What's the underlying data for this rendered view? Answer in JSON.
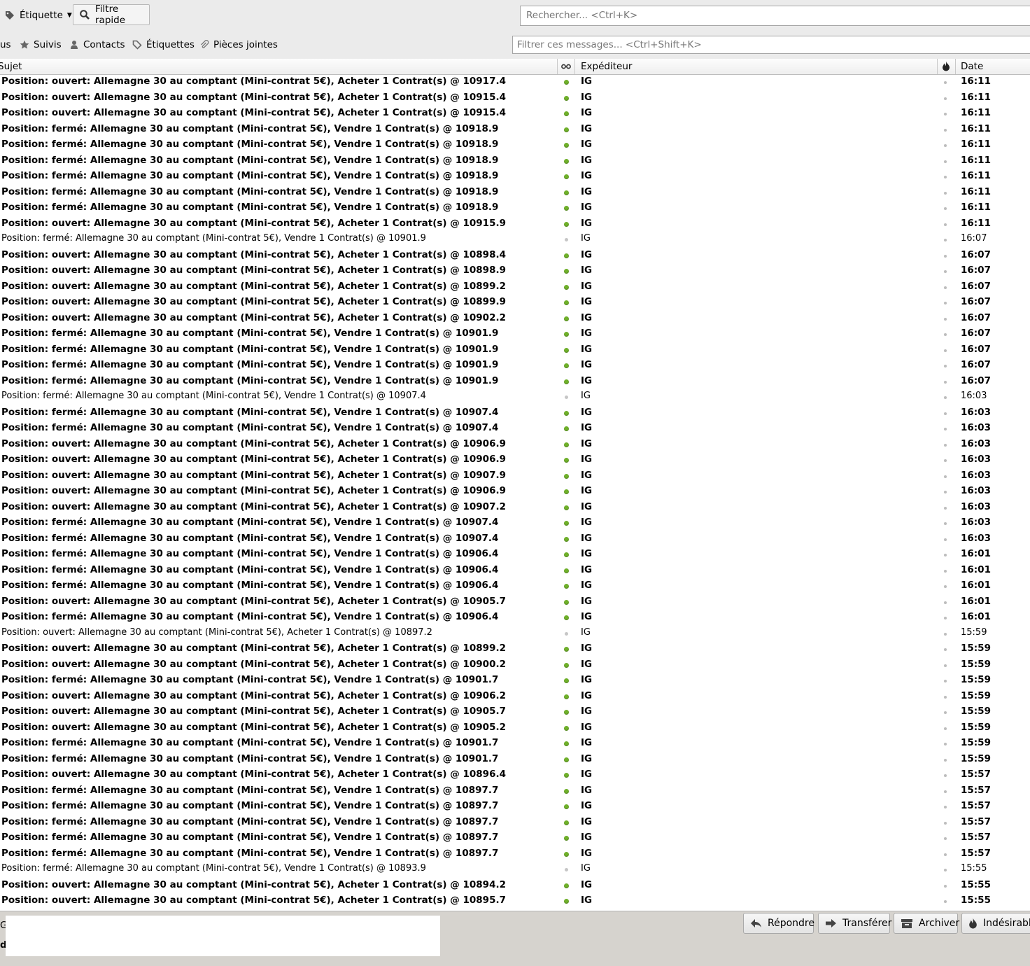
{
  "toolbar": {
    "tag_button_label": "Étiquette",
    "quick_filter_label": "Filtre rapide",
    "search_placeholder": "Rechercher... <Ctrl+K>"
  },
  "filterbar": {
    "partial_label": "us",
    "starred_label": "Suivis",
    "contacts_label": "Contacts",
    "tags_label": "Étiquettes",
    "attachments_label": "Pièces jointes",
    "filter_placeholder": "Filtrer ces messages... <Ctrl+Shift+K>"
  },
  "columns": {
    "subject": "Sujet",
    "sender": "Expéditeur",
    "date": "Date"
  },
  "messages": [
    {
      "subject": "Position: ouvert: Allemagne 30 au comptant (Mini-contrat 5€), Acheter 1 Contrat(s) @ 10917.4",
      "from": "IG",
      "date": "16:11",
      "unread": true
    },
    {
      "subject": "Position: ouvert: Allemagne 30 au comptant (Mini-contrat 5€), Acheter 1 Contrat(s) @ 10915.4",
      "from": "IG",
      "date": "16:11",
      "unread": true
    },
    {
      "subject": "Position: ouvert: Allemagne 30 au comptant (Mini-contrat 5€), Acheter 1 Contrat(s) @ 10915.4",
      "from": "IG",
      "date": "16:11",
      "unread": true
    },
    {
      "subject": "Position: fermé: Allemagne 30 au comptant (Mini-contrat 5€), Vendre 1 Contrat(s) @ 10918.9",
      "from": "IG",
      "date": "16:11",
      "unread": true
    },
    {
      "subject": "Position: fermé: Allemagne 30 au comptant (Mini-contrat 5€), Vendre 1 Contrat(s) @ 10918.9",
      "from": "IG",
      "date": "16:11",
      "unread": true
    },
    {
      "subject": "Position: fermé: Allemagne 30 au comptant (Mini-contrat 5€), Vendre 1 Contrat(s) @ 10918.9",
      "from": "IG",
      "date": "16:11",
      "unread": true
    },
    {
      "subject": "Position: fermé: Allemagne 30 au comptant (Mini-contrat 5€), Vendre 1 Contrat(s) @ 10918.9",
      "from": "IG",
      "date": "16:11",
      "unread": true
    },
    {
      "subject": "Position: fermé: Allemagne 30 au comptant (Mini-contrat 5€), Vendre 1 Contrat(s) @ 10918.9",
      "from": "IG",
      "date": "16:11",
      "unread": true
    },
    {
      "subject": "Position: fermé: Allemagne 30 au comptant (Mini-contrat 5€), Vendre 1 Contrat(s) @ 10918.9",
      "from": "IG",
      "date": "16:11",
      "unread": true
    },
    {
      "subject": "Position: ouvert: Allemagne 30 au comptant (Mini-contrat 5€), Acheter 1 Contrat(s) @ 10915.9",
      "from": "IG",
      "date": "16:11",
      "unread": true
    },
    {
      "subject": "Position: fermé: Allemagne 30 au comptant (Mini-contrat 5€), Vendre 1 Contrat(s) @ 10901.9",
      "from": "IG",
      "date": "16:07",
      "unread": false
    },
    {
      "subject": "Position: ouvert: Allemagne 30 au comptant (Mini-contrat 5€), Acheter 1 Contrat(s) @ 10898.4",
      "from": "IG",
      "date": "16:07",
      "unread": true
    },
    {
      "subject": "Position: ouvert: Allemagne 30 au comptant (Mini-contrat 5€), Acheter 1 Contrat(s) @ 10898.9",
      "from": "IG",
      "date": "16:07",
      "unread": true
    },
    {
      "subject": "Position: ouvert: Allemagne 30 au comptant (Mini-contrat 5€), Acheter 1 Contrat(s) @ 10899.2",
      "from": "IG",
      "date": "16:07",
      "unread": true
    },
    {
      "subject": "Position: ouvert: Allemagne 30 au comptant (Mini-contrat 5€), Acheter 1 Contrat(s) @ 10899.9",
      "from": "IG",
      "date": "16:07",
      "unread": true
    },
    {
      "subject": "Position: ouvert: Allemagne 30 au comptant (Mini-contrat 5€), Acheter 1 Contrat(s) @ 10902.2",
      "from": "IG",
      "date": "16:07",
      "unread": true
    },
    {
      "subject": "Position: fermé: Allemagne 30 au comptant (Mini-contrat 5€), Vendre 1 Contrat(s) @ 10901.9",
      "from": "IG",
      "date": "16:07",
      "unread": true
    },
    {
      "subject": "Position: fermé: Allemagne 30 au comptant (Mini-contrat 5€), Vendre 1 Contrat(s) @ 10901.9",
      "from": "IG",
      "date": "16:07",
      "unread": true
    },
    {
      "subject": "Position: fermé: Allemagne 30 au comptant (Mini-contrat 5€), Vendre 1 Contrat(s) @ 10901.9",
      "from": "IG",
      "date": "16:07",
      "unread": true
    },
    {
      "subject": "Position: fermé: Allemagne 30 au comptant (Mini-contrat 5€), Vendre 1 Contrat(s) @ 10901.9",
      "from": "IG",
      "date": "16:07",
      "unread": true
    },
    {
      "subject": "Position: fermé: Allemagne 30 au comptant (Mini-contrat 5€), Vendre 1 Contrat(s) @ 10907.4",
      "from": "IG",
      "date": "16:03",
      "unread": false
    },
    {
      "subject": "Position: fermé: Allemagne 30 au comptant (Mini-contrat 5€), Vendre 1 Contrat(s) @ 10907.4",
      "from": "IG",
      "date": "16:03",
      "unread": true
    },
    {
      "subject": "Position: fermé: Allemagne 30 au comptant (Mini-contrat 5€), Vendre 1 Contrat(s) @ 10907.4",
      "from": "IG",
      "date": "16:03",
      "unread": true
    },
    {
      "subject": "Position: ouvert: Allemagne 30 au comptant (Mini-contrat 5€), Acheter 1 Contrat(s) @ 10906.9",
      "from": "IG",
      "date": "16:03",
      "unread": true
    },
    {
      "subject": "Position: ouvert: Allemagne 30 au comptant (Mini-contrat 5€), Acheter 1 Contrat(s) @ 10906.9",
      "from": "IG",
      "date": "16:03",
      "unread": true
    },
    {
      "subject": "Position: ouvert: Allemagne 30 au comptant (Mini-contrat 5€), Acheter 1 Contrat(s) @ 10907.9",
      "from": "IG",
      "date": "16:03",
      "unread": true
    },
    {
      "subject": "Position: ouvert: Allemagne 30 au comptant (Mini-contrat 5€), Acheter 1 Contrat(s) @ 10906.9",
      "from": "IG",
      "date": "16:03",
      "unread": true
    },
    {
      "subject": "Position: ouvert: Allemagne 30 au comptant (Mini-contrat 5€), Acheter 1 Contrat(s) @ 10907.2",
      "from": "IG",
      "date": "16:03",
      "unread": true
    },
    {
      "subject": "Position: fermé: Allemagne 30 au comptant (Mini-contrat 5€), Vendre 1 Contrat(s) @ 10907.4",
      "from": "IG",
      "date": "16:03",
      "unread": true
    },
    {
      "subject": "Position: fermé: Allemagne 30 au comptant (Mini-contrat 5€), Vendre 1 Contrat(s) @ 10907.4",
      "from": "IG",
      "date": "16:03",
      "unread": true
    },
    {
      "subject": "Position: fermé: Allemagne 30 au comptant (Mini-contrat 5€), Vendre 1 Contrat(s) @ 10906.4",
      "from": "IG",
      "date": "16:01",
      "unread": true
    },
    {
      "subject": "Position: fermé: Allemagne 30 au comptant (Mini-contrat 5€), Vendre 1 Contrat(s) @ 10906.4",
      "from": "IG",
      "date": "16:01",
      "unread": true
    },
    {
      "subject": "Position: fermé: Allemagne 30 au comptant (Mini-contrat 5€), Vendre 1 Contrat(s) @ 10906.4",
      "from": "IG",
      "date": "16:01",
      "unread": true
    },
    {
      "subject": "Position: ouvert: Allemagne 30 au comptant (Mini-contrat 5€), Acheter 1 Contrat(s) @ 10905.7",
      "from": "IG",
      "date": "16:01",
      "unread": true
    },
    {
      "subject": "Position: fermé: Allemagne 30 au comptant (Mini-contrat 5€), Vendre 1 Contrat(s) @ 10906.4",
      "from": "IG",
      "date": "16:01",
      "unread": true
    },
    {
      "subject": "Position: ouvert: Allemagne 30 au comptant (Mini-contrat 5€), Acheter 1 Contrat(s) @ 10897.2",
      "from": "IG",
      "date": "15:59",
      "unread": false
    },
    {
      "subject": "Position: ouvert: Allemagne 30 au comptant (Mini-contrat 5€), Acheter 1 Contrat(s) @ 10899.2",
      "from": "IG",
      "date": "15:59",
      "unread": true
    },
    {
      "subject": "Position: ouvert: Allemagne 30 au comptant (Mini-contrat 5€), Acheter 1 Contrat(s) @ 10900.2",
      "from": "IG",
      "date": "15:59",
      "unread": true
    },
    {
      "subject": "Position: fermé: Allemagne 30 au comptant (Mini-contrat 5€), Vendre 1 Contrat(s) @ 10901.7",
      "from": "IG",
      "date": "15:59",
      "unread": true
    },
    {
      "subject": "Position: ouvert: Allemagne 30 au comptant (Mini-contrat 5€), Acheter 1 Contrat(s) @ 10906.2",
      "from": "IG",
      "date": "15:59",
      "unread": true
    },
    {
      "subject": "Position: ouvert: Allemagne 30 au comptant (Mini-contrat 5€), Acheter 1 Contrat(s) @ 10905.7",
      "from": "IG",
      "date": "15:59",
      "unread": true
    },
    {
      "subject": "Position: ouvert: Allemagne 30 au comptant (Mini-contrat 5€), Acheter 1 Contrat(s) @ 10905.2",
      "from": "IG",
      "date": "15:59",
      "unread": true
    },
    {
      "subject": "Position: fermé: Allemagne 30 au comptant (Mini-contrat 5€), Vendre 1 Contrat(s) @ 10901.7",
      "from": "IG",
      "date": "15:59",
      "unread": true
    },
    {
      "subject": "Position: fermé: Allemagne 30 au comptant (Mini-contrat 5€), Vendre 1 Contrat(s) @ 10901.7",
      "from": "IG",
      "date": "15:59",
      "unread": true
    },
    {
      "subject": "Position: ouvert: Allemagne 30 au comptant (Mini-contrat 5€), Acheter 1 Contrat(s) @ 10896.4",
      "from": "IG",
      "date": "15:57",
      "unread": true
    },
    {
      "subject": "Position: fermé: Allemagne 30 au comptant (Mini-contrat 5€), Vendre 1 Contrat(s) @ 10897.7",
      "from": "IG",
      "date": "15:57",
      "unread": true
    },
    {
      "subject": "Position: fermé: Allemagne 30 au comptant (Mini-contrat 5€), Vendre 1 Contrat(s) @ 10897.7",
      "from": "IG",
      "date": "15:57",
      "unread": true
    },
    {
      "subject": "Position: fermé: Allemagne 30 au comptant (Mini-contrat 5€), Vendre 1 Contrat(s) @ 10897.7",
      "from": "IG",
      "date": "15:57",
      "unread": true
    },
    {
      "subject": "Position: fermé: Allemagne 30 au comptant (Mini-contrat 5€), Vendre 1 Contrat(s) @ 10897.7",
      "from": "IG",
      "date": "15:57",
      "unread": true
    },
    {
      "subject": "Position: fermé: Allemagne 30 au comptant (Mini-contrat 5€), Vendre 1 Contrat(s) @ 10897.7",
      "from": "IG",
      "date": "15:57",
      "unread": true
    },
    {
      "subject": "Position: fermé: Allemagne 30 au comptant (Mini-contrat 5€), Vendre 1 Contrat(s) @ 10893.9",
      "from": "IG",
      "date": "15:55",
      "unread": false
    },
    {
      "subject": "Position: ouvert: Allemagne 30 au comptant (Mini-contrat 5€), Acheter 1 Contrat(s) @ 10894.2",
      "from": "IG",
      "date": "15:55",
      "unread": true
    },
    {
      "subject": "Position: ouvert: Allemagne 30 au comptant (Mini-contrat 5€), Acheter 1 Contrat(s) @ 10895.7",
      "from": "IG",
      "date": "15:55",
      "unread": true
    }
  ],
  "bottom": {
    "partial_g": "G",
    "partial_d": "d",
    "reply_label": "Répondre",
    "forward_label": "Transférer",
    "archive_label": "Archiver",
    "junk_label": "Indésirable"
  },
  "colors": {
    "unread_dot": "#6fb02a",
    "read_dot": "#c6c6c6"
  }
}
